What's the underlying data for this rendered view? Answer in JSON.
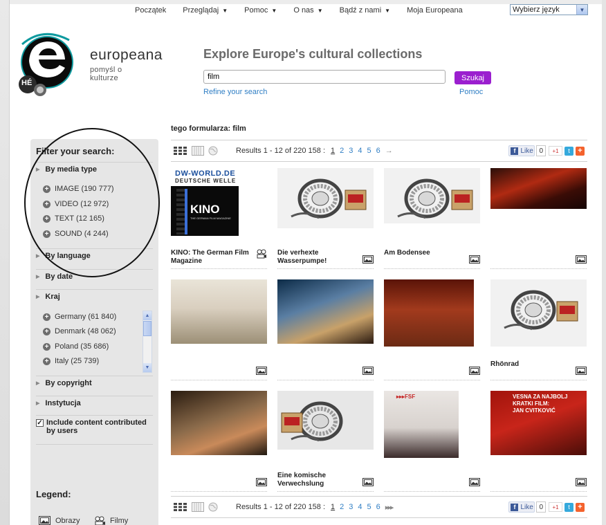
{
  "topnav": {
    "items": [
      {
        "label": "Początek",
        "dropdown": false
      },
      {
        "label": "Przeglądaj",
        "dropdown": true
      },
      {
        "label": "Pomoc",
        "dropdown": true
      },
      {
        "label": "O nas",
        "dropdown": true
      },
      {
        "label": "Bądź z nami",
        "dropdown": true
      },
      {
        "label": "Moja Europeana",
        "dropdown": false
      }
    ],
    "language_select": "Wybierz język"
  },
  "brand": {
    "name": "europeana",
    "tagline": "pomyśl o kulturze",
    "badge": "HÉ",
    "colors": {
      "purple": "#9b1fcf",
      "teal": "#0e9a9f",
      "link": "#2f7ec4"
    }
  },
  "search": {
    "headline": "Explore Europe's cultural collections",
    "value": "film",
    "button": "Szukaj",
    "refine": "Refine your search",
    "help": "Pomoc"
  },
  "sidebar": {
    "title": "Filter your search:",
    "media_type": {
      "label": "By media type",
      "options": [
        {
          "label": "IMAGE (190 777)"
        },
        {
          "label": "VIDEO (12 972)"
        },
        {
          "label": "TEXT (12 165)"
        },
        {
          "label": "SOUND (4 244)"
        }
      ]
    },
    "language": "By language",
    "date": "By date",
    "country": {
      "label": "Kraj",
      "options": [
        {
          "label": "Germany (61 840)"
        },
        {
          "label": "Denmark (48 062)"
        },
        {
          "label": "Poland (35 686)"
        },
        {
          "label": "Italy (25 739)"
        }
      ]
    },
    "copyright": "By copyright",
    "institution": "Instytucja",
    "include_users": "Include content contributed by users",
    "legend_title": "Legend:",
    "legend": [
      {
        "label": "Obrazy",
        "icon": "image-icon"
      },
      {
        "label": "Filmy",
        "icon": "film-icon"
      }
    ]
  },
  "results": {
    "query_label": "tego formularza: film",
    "count_text": "Results 1 - 12 of 220 158 :",
    "pages": [
      "1",
      "2",
      "3",
      "4",
      "5",
      "6"
    ],
    "next": "→",
    "share": {
      "like": "Like",
      "like_count": "0",
      "gplus": "+1"
    },
    "items": [
      {
        "title": "KINO: The German Film Magazine",
        "type": "video",
        "thumb": "dw-kino",
        "logo_line1": "DW-WORLD.DE",
        "logo_line2": "DEUTSCHE WELLE",
        "logo_word": "KINO",
        "logo_sub": "THE GERMAN FILM MAGAZINE"
      },
      {
        "title": "Die verhexte Wasserpumpe!",
        "type": "image",
        "thumb": "reel-box"
      },
      {
        "title": "Am Bodensee",
        "type": "image",
        "thumb": "reel-box2"
      },
      {
        "title": "",
        "type": "image",
        "thumb": "stage"
      },
      {
        "title": "",
        "type": "image",
        "thumb": "people-outdoor"
      },
      {
        "title": "",
        "type": "image",
        "thumb": "masks"
      },
      {
        "title": "",
        "type": "image",
        "thumb": "audience"
      },
      {
        "title": "Rhönrad",
        "type": "image",
        "thumb": "reel-box3"
      },
      {
        "title": "",
        "type": "image",
        "thumb": "hug"
      },
      {
        "title": "Eine komische Verwechslung",
        "type": "image",
        "thumb": "reel-box4"
      },
      {
        "title": "",
        "type": "image",
        "thumb": "festival",
        "text": "FSF"
      },
      {
        "title": "",
        "type": "image",
        "thumb": "speaker",
        "text1": "VESNA ZA NAJBOLJ",
        "text2": "KRATKI FILM:",
        "text3": "JAN CVITKOVIĆ"
      }
    ]
  }
}
